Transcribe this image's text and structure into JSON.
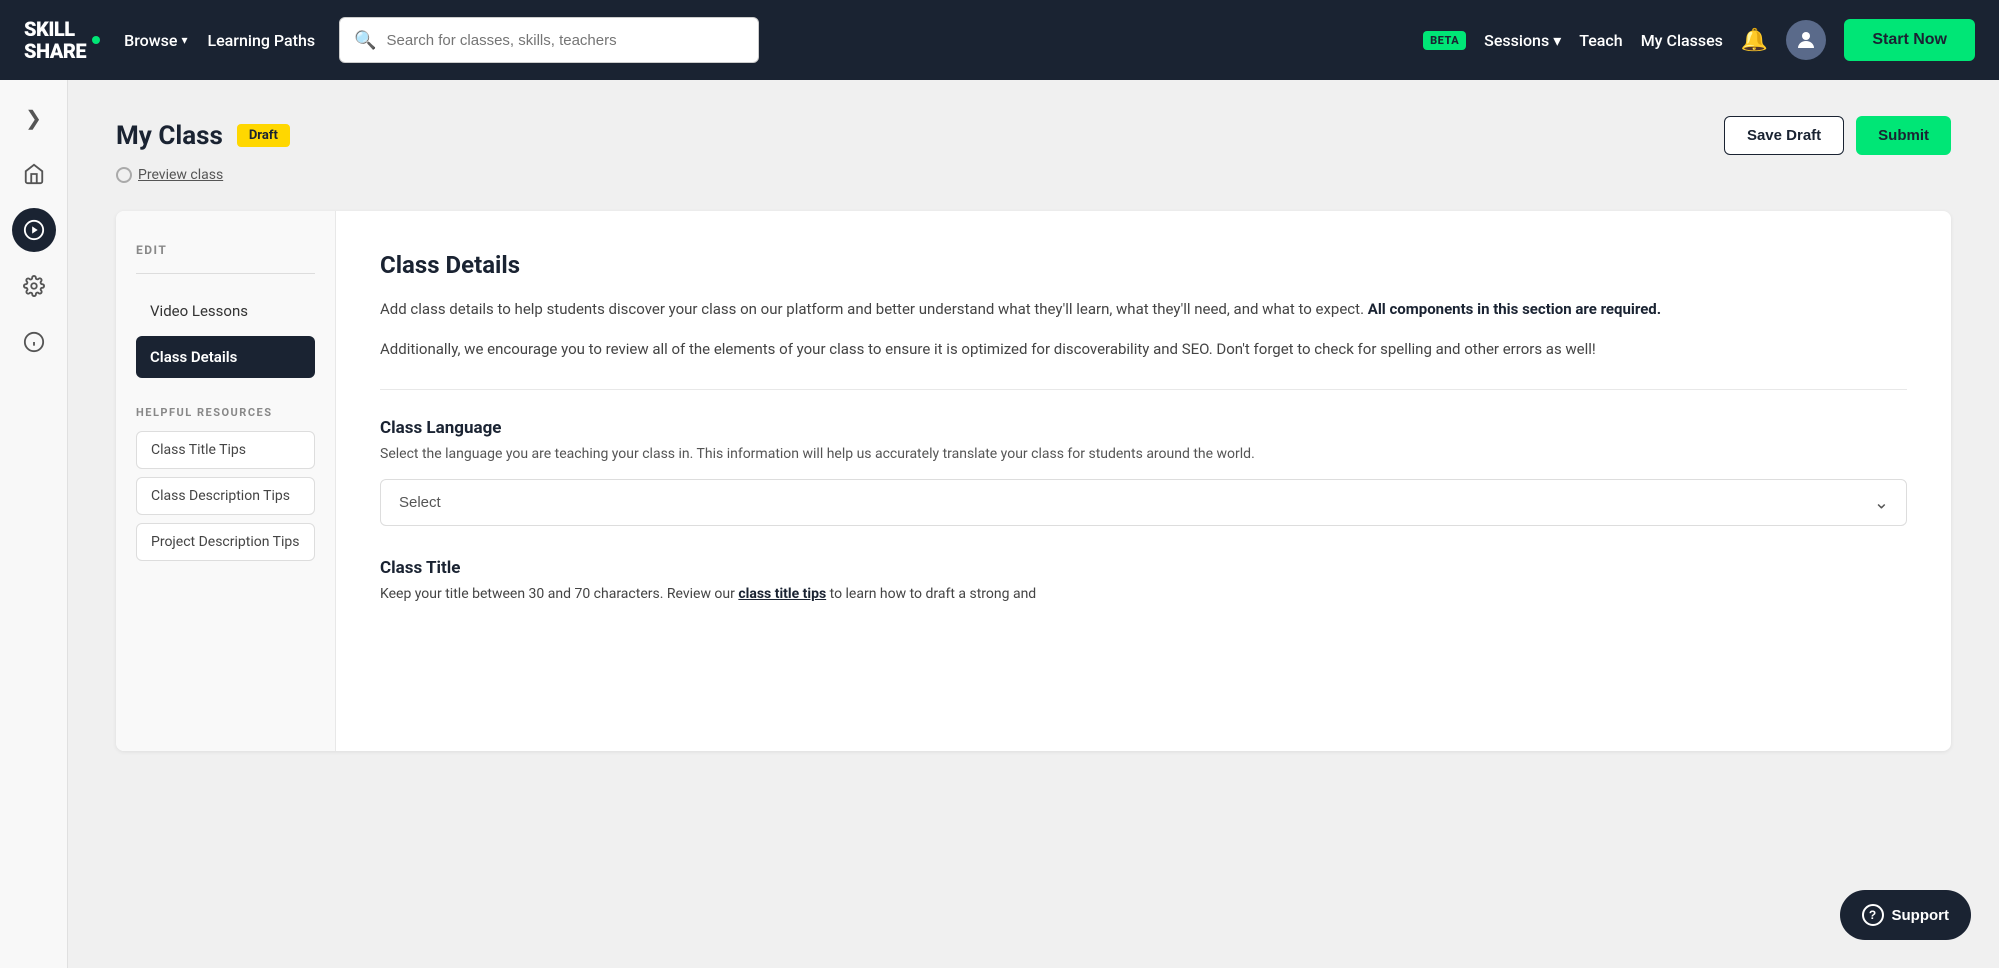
{
  "navbar": {
    "logo_line1": "SKILL",
    "logo_line2": "SHaRe",
    "browse_label": "Browse",
    "learning_paths_label": "Learning Paths",
    "search_placeholder": "Search for classes, skills, teachers",
    "beta_label": "BETA",
    "sessions_label": "Sessions",
    "teach_label": "Teach",
    "my_classes_label": "My Classes",
    "start_now_label": "Start Now"
  },
  "sidebar_icons": [
    {
      "name": "expand-icon",
      "symbol": "❯",
      "active": false
    },
    {
      "name": "home-icon",
      "symbol": "⌂",
      "active": false
    },
    {
      "name": "play-icon",
      "symbol": "▶",
      "active": true
    },
    {
      "name": "gear-icon",
      "symbol": "⚙",
      "active": false
    },
    {
      "name": "info-icon",
      "symbol": "ⓘ",
      "active": false
    }
  ],
  "page": {
    "title": "My Class",
    "draft_badge": "Draft",
    "preview_link": "Preview class",
    "save_draft_label": "Save Draft",
    "submit_label": "Submit"
  },
  "left_panel": {
    "edit_label": "EDIT",
    "menu_items": [
      {
        "label": "Video Lessons",
        "active": false
      },
      {
        "label": "Class Details",
        "active": true
      }
    ],
    "resources_label": "HELPFUL RESOURCES",
    "resource_items": [
      {
        "label": "Class Title Tips"
      },
      {
        "label": "Class Description Tips"
      },
      {
        "label": "Project Description Tips"
      }
    ]
  },
  "right_panel": {
    "section_title": "Class Details",
    "section_desc_part1": "Add class details to help students discover your class on our platform and better understand what they'll learn, what they'll need, and what to expect. ",
    "section_desc_bold": "All components in this section are required.",
    "section_desc2": "Additionally, we encourage you to review all of the elements of your class to ensure it is optimized for discoverability and SEO. Don't forget to check for spelling and other errors as well!",
    "language_label": "Class Language",
    "language_desc": "Select the language you are teaching your class in. This information will help us accurately translate your class for students around the world.",
    "language_select_placeholder": "Select",
    "title_label": "Class Title",
    "title_desc_part1": "Keep your title between 30 and 70 characters. Review our ",
    "title_desc_link": "class title tips",
    "title_desc_part2": " to learn how to draft a strong and"
  },
  "support": {
    "label": "Support"
  }
}
